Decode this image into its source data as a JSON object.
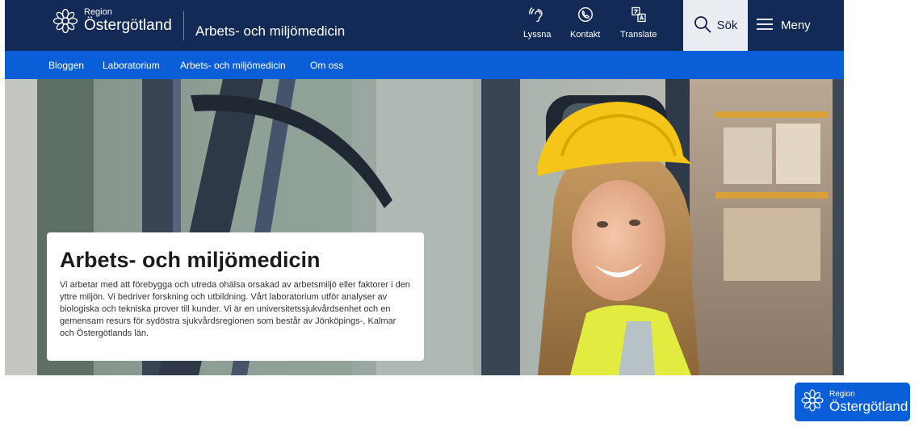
{
  "header": {
    "logo_small": "Region",
    "logo_big": "Östergötland",
    "site_title": "Arbets- och miljömedicin",
    "tools": [
      {
        "icon": "ear-icon",
        "label": "Lyssna"
      },
      {
        "icon": "phone-icon",
        "label": "Kontakt"
      },
      {
        "icon": "translate-icon",
        "label": "Translate"
      }
    ],
    "search_label": "Sök",
    "menu_label": "Meny"
  },
  "subnav": {
    "items": [
      {
        "label": "Bloggen"
      },
      {
        "label": "Laboratorium"
      },
      {
        "label": "Arbets- och miljömedicin"
      },
      {
        "label": "Om oss"
      }
    ]
  },
  "hero": {
    "title": "Arbets- och miljömedicin",
    "text": "Vi arbetar med att förebygga och utreda ohälsa orsakad av arbetsmiljö eller faktorer i den yttre miljön. Vi bedriver forskning och utbildning. Vårt laboratorium utför analyser av biologiska och tekniska prover till kunder. Vi är en universitetssjukvårdsenhet och en gemensam resurs för sydöstra sjukvårdsregionen som består av Jönköpings-, Kalmar och Östergötlands län."
  },
  "footer": {
    "logo_small": "Region",
    "logo_big": "Östergötland"
  },
  "colors": {
    "header_bg": "#122a55",
    "subnav_bg": "#0a5fd8",
    "search_bg": "#e9edf2"
  }
}
